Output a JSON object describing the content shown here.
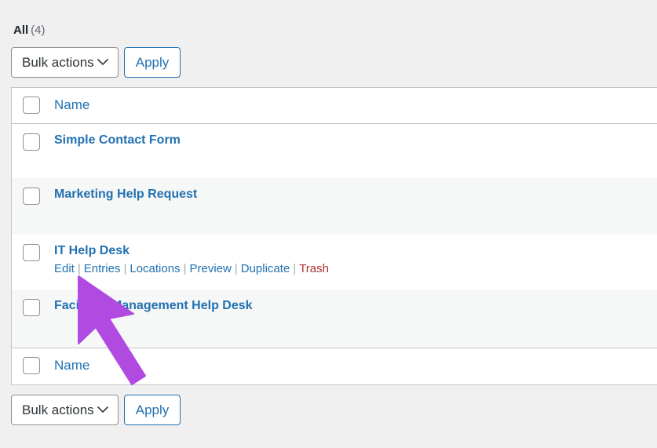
{
  "views": {
    "label": "All",
    "count": "(4)"
  },
  "toolbar_top": {
    "bulk_actions_label": "Bulk actions",
    "bulk_actions_chevron": "chevron-down-icon",
    "apply_label": "Apply"
  },
  "toolbar_bottom": {
    "bulk_actions_label": "Bulk actions",
    "bulk_actions_chevron": "chevron-down-icon",
    "apply_label": "Apply"
  },
  "table": {
    "column_header": "Name",
    "column_footer": "Name",
    "rows": [
      {
        "title": "Simple Contact Form",
        "actions": []
      },
      {
        "title": "Marketing Help Request",
        "actions": []
      },
      {
        "title": "IT Help Desk",
        "actions": [
          {
            "label": "Edit",
            "kind": "link"
          },
          {
            "label": "Entries",
            "kind": "link"
          },
          {
            "label": "Locations",
            "kind": "link"
          },
          {
            "label": "Preview",
            "kind": "link"
          },
          {
            "label": "Duplicate",
            "kind": "link"
          },
          {
            "label": "Trash",
            "kind": "trash"
          }
        ]
      },
      {
        "title": "Facilities Management Help Desk",
        "actions": []
      }
    ],
    "separator": "|"
  },
  "cursor": {
    "name": "mouse-pointer-arrow",
    "color": "#b14ae0"
  },
  "colors": {
    "link": "#2271b1",
    "trash": "#b32d2e",
    "page_bg": "#f0f0f1",
    "row_alt_bg": "#f6f7f7",
    "border": "#c3c4c7",
    "text": "#3c434a"
  }
}
